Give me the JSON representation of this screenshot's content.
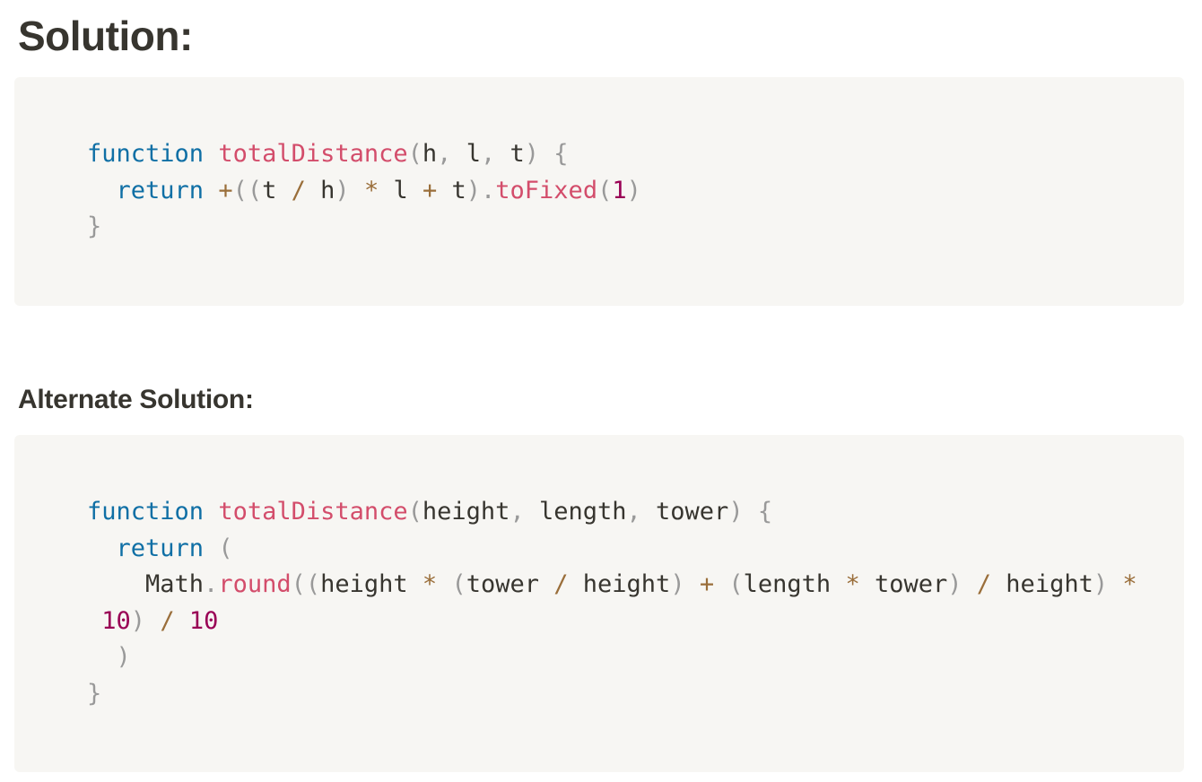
{
  "solution": {
    "heading": "Solution:",
    "code_lines": [
      [
        {
          "t": "function",
          "c": "kw"
        },
        {
          "t": " ",
          "c": "plain"
        },
        {
          "t": "totalDistance",
          "c": "fn"
        },
        {
          "t": "(",
          "c": "punc"
        },
        {
          "t": "h",
          "c": "plain"
        },
        {
          "t": ",",
          "c": "punc"
        },
        {
          "t": " l",
          "c": "plain"
        },
        {
          "t": ",",
          "c": "punc"
        },
        {
          "t": " t",
          "c": "plain"
        },
        {
          "t": ")",
          "c": "punc"
        },
        {
          "t": " ",
          "c": "plain"
        },
        {
          "t": "{",
          "c": "punc"
        }
      ],
      [
        {
          "t": "  ",
          "c": "plain"
        },
        {
          "t": "return",
          "c": "kw"
        },
        {
          "t": " ",
          "c": "plain"
        },
        {
          "t": "+",
          "c": "op"
        },
        {
          "t": "((",
          "c": "punc"
        },
        {
          "t": "t ",
          "c": "plain"
        },
        {
          "t": "/",
          "c": "op"
        },
        {
          "t": " h",
          "c": "plain"
        },
        {
          "t": ")",
          "c": "punc"
        },
        {
          "t": " ",
          "c": "plain"
        },
        {
          "t": "*",
          "c": "op"
        },
        {
          "t": " l ",
          "c": "plain"
        },
        {
          "t": "+",
          "c": "op"
        },
        {
          "t": " t",
          "c": "plain"
        },
        {
          "t": ").",
          "c": "punc"
        },
        {
          "t": "toFixed",
          "c": "fn"
        },
        {
          "t": "(",
          "c": "punc"
        },
        {
          "t": "1",
          "c": "num"
        },
        {
          "t": ")",
          "c": "punc"
        }
      ],
      [
        {
          "t": "}",
          "c": "punc"
        }
      ]
    ]
  },
  "alternate_solution": {
    "heading": "Alternate Solution:",
    "code_lines": [
      [
        {
          "t": "function",
          "c": "kw"
        },
        {
          "t": " ",
          "c": "plain"
        },
        {
          "t": "totalDistance",
          "c": "fn"
        },
        {
          "t": "(",
          "c": "punc"
        },
        {
          "t": "height",
          "c": "plain"
        },
        {
          "t": ",",
          "c": "punc"
        },
        {
          "t": " length",
          "c": "plain"
        },
        {
          "t": ",",
          "c": "punc"
        },
        {
          "t": " tower",
          "c": "plain"
        },
        {
          "t": ")",
          "c": "punc"
        },
        {
          "t": " ",
          "c": "plain"
        },
        {
          "t": "{",
          "c": "punc"
        }
      ],
      [
        {
          "t": "  ",
          "c": "plain"
        },
        {
          "t": "return",
          "c": "kw"
        },
        {
          "t": " ",
          "c": "plain"
        },
        {
          "t": "(",
          "c": "punc"
        }
      ],
      [
        {
          "t": "    Math",
          "c": "plain"
        },
        {
          "t": ".",
          "c": "punc"
        },
        {
          "t": "round",
          "c": "fn"
        },
        {
          "t": "((",
          "c": "punc"
        },
        {
          "t": "height ",
          "c": "plain"
        },
        {
          "t": "*",
          "c": "op"
        },
        {
          "t": " ",
          "c": "plain"
        },
        {
          "t": "(",
          "c": "punc"
        },
        {
          "t": "tower ",
          "c": "plain"
        },
        {
          "t": "/",
          "c": "op"
        },
        {
          "t": " height",
          "c": "plain"
        },
        {
          "t": ")",
          "c": "punc"
        },
        {
          "t": " ",
          "c": "plain"
        },
        {
          "t": "+",
          "c": "op"
        },
        {
          "t": " ",
          "c": "plain"
        },
        {
          "t": "(",
          "c": "punc"
        },
        {
          "t": "length ",
          "c": "plain"
        },
        {
          "t": "*",
          "c": "op"
        },
        {
          "t": " tower",
          "c": "plain"
        },
        {
          "t": ")",
          "c": "punc"
        },
        {
          "t": " ",
          "c": "plain"
        },
        {
          "t": "/",
          "c": "op"
        },
        {
          "t": " height",
          "c": "plain"
        },
        {
          "t": ")",
          "c": "punc"
        },
        {
          "t": " ",
          "c": "plain"
        },
        {
          "t": "*",
          "c": "op"
        }
      ],
      [
        {
          "t": " ",
          "c": "plain"
        },
        {
          "t": "10",
          "c": "num"
        },
        {
          "t": ")",
          "c": "punc"
        },
        {
          "t": " ",
          "c": "plain"
        },
        {
          "t": "/",
          "c": "op"
        },
        {
          "t": " ",
          "c": "plain"
        },
        {
          "t": "10",
          "c": "num"
        }
      ],
      [
        {
          "t": "  ",
          "c": "plain"
        },
        {
          "t": ")",
          "c": "punc"
        }
      ],
      [
        {
          "t": "}",
          "c": "punc"
        }
      ]
    ]
  },
  "colors": {
    "keyword": "#0f6fa5",
    "function_name": "#d34d6b",
    "punctuation": "#999999",
    "operator": "#9a6e3a",
    "number": "#990055",
    "text": "#37352f",
    "code_background": "#f7f6f3"
  }
}
